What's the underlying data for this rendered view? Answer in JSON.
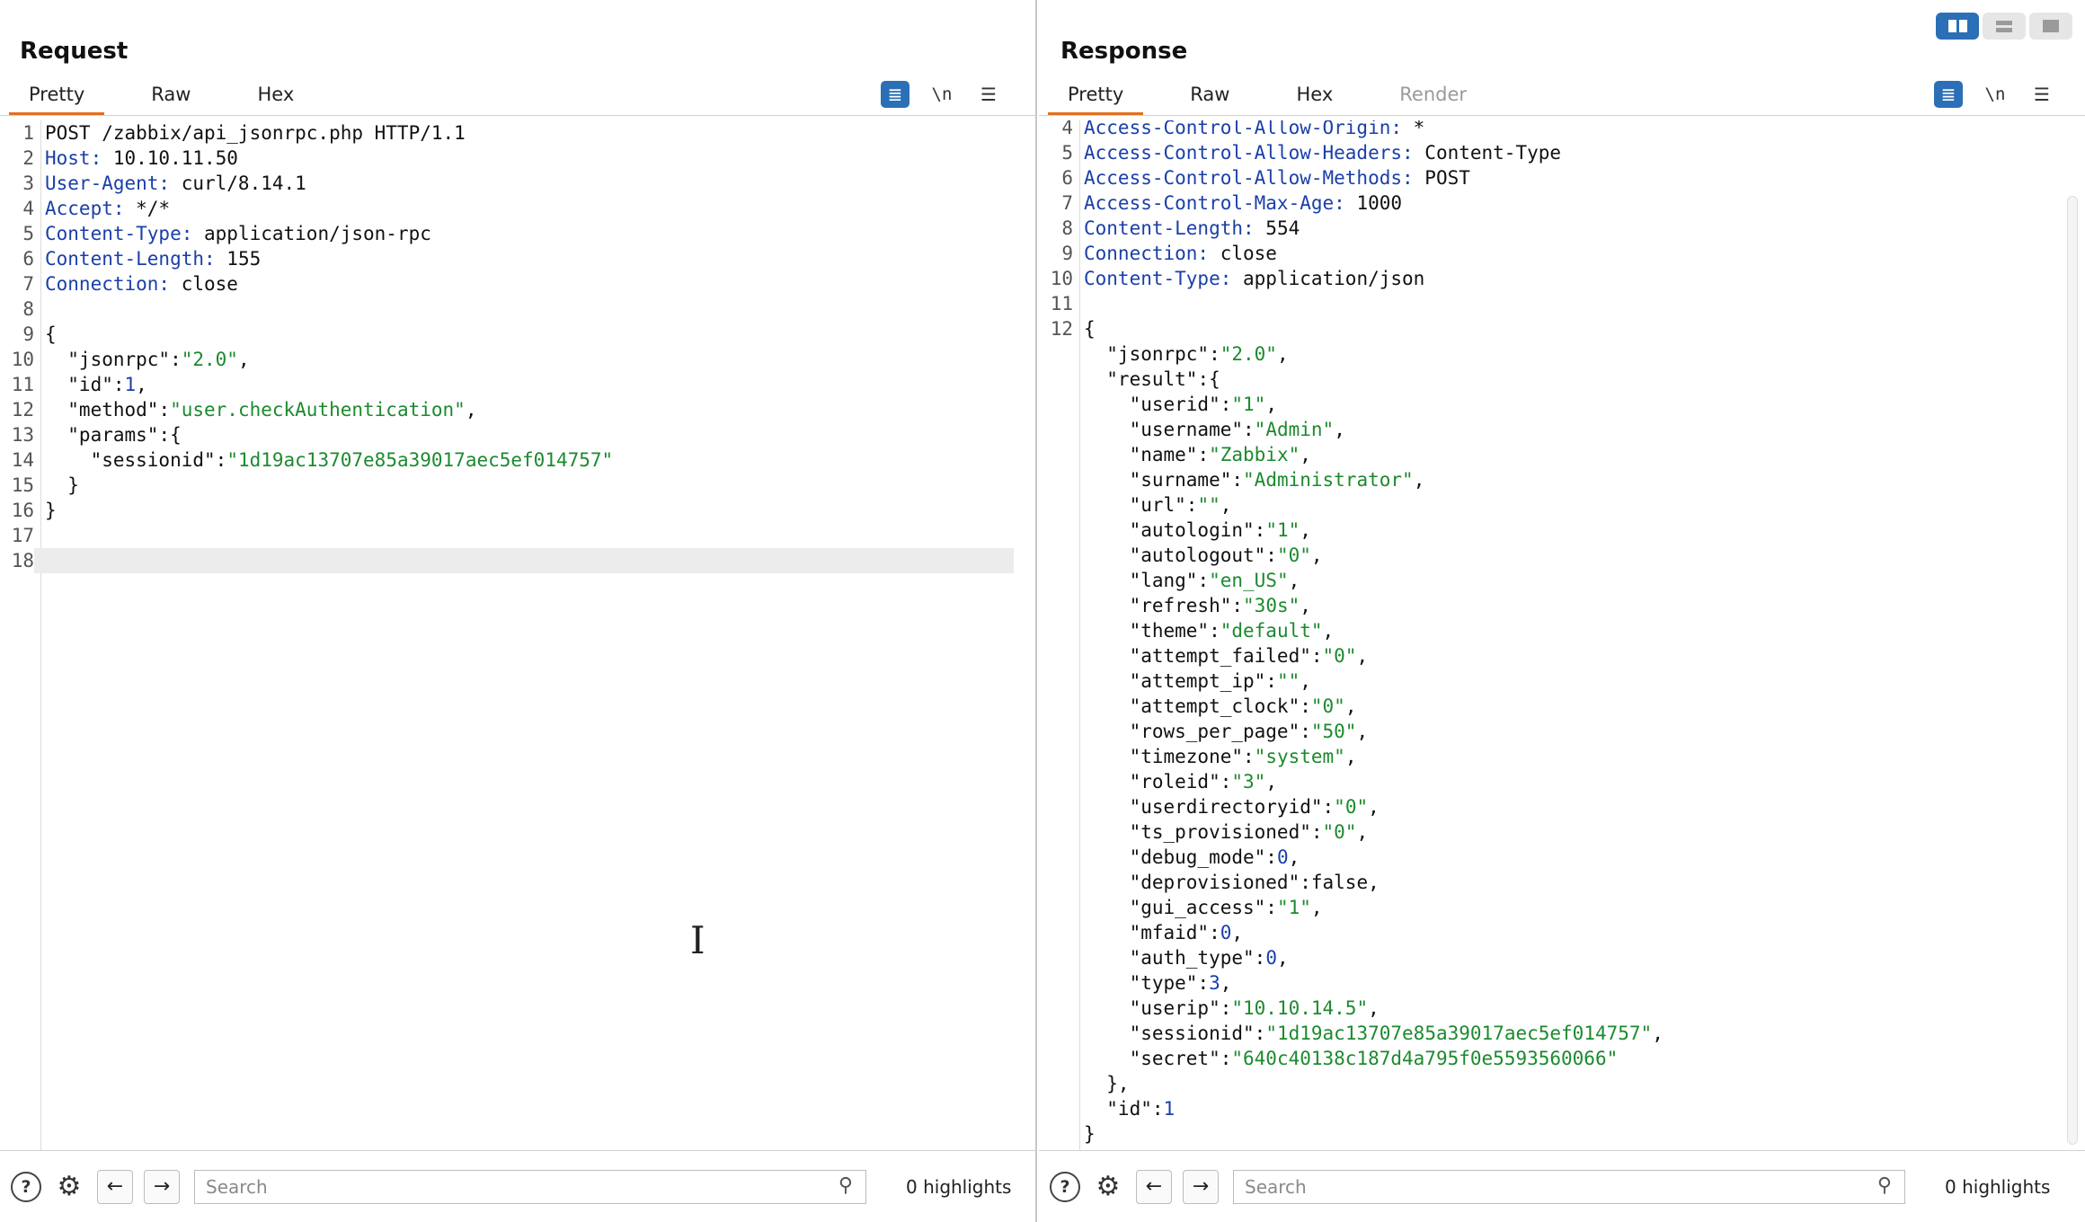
{
  "request": {
    "title": "Request",
    "tabs": [
      {
        "label": "Pretty",
        "active": true
      },
      {
        "label": "Raw",
        "active": false
      },
      {
        "label": "Hex",
        "active": false
      }
    ],
    "toolbar": {
      "wrap_icon": "wrap-lines-icon",
      "newline_label": "\\n",
      "menu_icon": "menu-icon"
    },
    "lines": [
      {
        "n": "1",
        "tokens": [
          {
            "t": "POST /zabbix/api_jsonrpc.php HTTP/1.1",
            "c": "hv"
          }
        ]
      },
      {
        "n": "2",
        "tokens": [
          {
            "t": "Host:",
            "c": "hk"
          },
          {
            "t": " 10.10.11.50",
            "c": "hv"
          }
        ]
      },
      {
        "n": "3",
        "tokens": [
          {
            "t": "User-Agent:",
            "c": "hk"
          },
          {
            "t": " curl/8.14.1",
            "c": "hv"
          }
        ]
      },
      {
        "n": "4",
        "tokens": [
          {
            "t": "Accept:",
            "c": "hk"
          },
          {
            "t": " */*",
            "c": "hv"
          }
        ]
      },
      {
        "n": "5",
        "tokens": [
          {
            "t": "Content-Type:",
            "c": "hk"
          },
          {
            "t": " application/json-rpc",
            "c": "hv"
          }
        ]
      },
      {
        "n": "6",
        "tokens": [
          {
            "t": "Content-Length:",
            "c": "hk"
          },
          {
            "t": " 155",
            "c": "hv"
          }
        ]
      },
      {
        "n": "7",
        "tokens": [
          {
            "t": "Connection:",
            "c": "hk"
          },
          {
            "t": " close",
            "c": "hv"
          }
        ]
      },
      {
        "n": "8",
        "tokens": []
      },
      {
        "n": "9",
        "tokens": [
          {
            "t": "{",
            "c": "p"
          }
        ]
      },
      {
        "n": "10",
        "tokens": [
          {
            "t": "  \"jsonrpc\"",
            "c": "jk"
          },
          {
            "t": ":",
            "c": "p"
          },
          {
            "t": "\"2.0\"",
            "c": "js"
          },
          {
            "t": ",",
            "c": "p"
          }
        ]
      },
      {
        "n": "11",
        "tokens": [
          {
            "t": "  \"id\"",
            "c": "jk"
          },
          {
            "t": ":",
            "c": "p"
          },
          {
            "t": "1",
            "c": "jn"
          },
          {
            "t": ",",
            "c": "p"
          }
        ]
      },
      {
        "n": "12",
        "tokens": [
          {
            "t": "  \"method\"",
            "c": "jk"
          },
          {
            "t": ":",
            "c": "p"
          },
          {
            "t": "\"user.checkAuthentication\"",
            "c": "js"
          },
          {
            "t": ",",
            "c": "p"
          }
        ]
      },
      {
        "n": "13",
        "tokens": [
          {
            "t": "  \"params\"",
            "c": "jk"
          },
          {
            "t": ":{",
            "c": "p"
          }
        ]
      },
      {
        "n": "14",
        "tokens": [
          {
            "t": "    \"sessionid\"",
            "c": "jk"
          },
          {
            "t": ":",
            "c": "p"
          },
          {
            "t": "\"1d19ac13707e85a39017aec5ef014757\"",
            "c": "js"
          }
        ]
      },
      {
        "n": "15",
        "tokens": [
          {
            "t": "  }",
            "c": "p"
          }
        ]
      },
      {
        "n": "16",
        "tokens": [
          {
            "t": "}",
            "c": "p"
          }
        ]
      },
      {
        "n": "17",
        "tokens": []
      },
      {
        "n": "18",
        "tokens": [],
        "current": true
      }
    ],
    "search_placeholder": "Search",
    "highlights": "0 highlights"
  },
  "response": {
    "title": "Response",
    "tabs": [
      {
        "label": "Pretty",
        "active": true
      },
      {
        "label": "Raw",
        "active": false
      },
      {
        "label": "Hex",
        "active": false
      },
      {
        "label": "Render",
        "active": false,
        "disabled": true
      }
    ],
    "toolbar": {
      "wrap_icon": "wrap-lines-icon",
      "newline_label": "\\n",
      "menu_icon": "menu-icon"
    },
    "lines": [
      {
        "n": "4",
        "tokens": [
          {
            "t": "Access-Control-Allow-Origin:",
            "c": "hk"
          },
          {
            "t": " *",
            "c": "hv"
          }
        ]
      },
      {
        "n": "5",
        "tokens": [
          {
            "t": "Access-Control-Allow-Headers:",
            "c": "hk"
          },
          {
            "t": " Content-Type",
            "c": "hv"
          }
        ]
      },
      {
        "n": "6",
        "tokens": [
          {
            "t": "Access-Control-Allow-Methods:",
            "c": "hk"
          },
          {
            "t": " POST",
            "c": "hv"
          }
        ]
      },
      {
        "n": "7",
        "tokens": [
          {
            "t": "Access-Control-Max-Age:",
            "c": "hk"
          },
          {
            "t": " 1000",
            "c": "hv"
          }
        ]
      },
      {
        "n": "8",
        "tokens": [
          {
            "t": "Content-Length:",
            "c": "hk"
          },
          {
            "t": " 554",
            "c": "hv"
          }
        ]
      },
      {
        "n": "9",
        "tokens": [
          {
            "t": "Connection:",
            "c": "hk"
          },
          {
            "t": " close",
            "c": "hv"
          }
        ]
      },
      {
        "n": "10",
        "tokens": [
          {
            "t": "Content-Type:",
            "c": "hk"
          },
          {
            "t": " application/json",
            "c": "hv"
          }
        ]
      },
      {
        "n": "11",
        "tokens": []
      },
      {
        "n": "12",
        "tokens": [
          {
            "t": "{",
            "c": "p"
          }
        ]
      },
      {
        "n": "",
        "tokens": [
          {
            "t": "  \"jsonrpc\"",
            "c": "jk"
          },
          {
            "t": ":",
            "c": "p"
          },
          {
            "t": "\"2.0\"",
            "c": "js"
          },
          {
            "t": ",",
            "c": "p"
          }
        ]
      },
      {
        "n": "",
        "tokens": [
          {
            "t": "  \"result\"",
            "c": "jk"
          },
          {
            "t": ":{",
            "c": "p"
          }
        ]
      },
      {
        "n": "",
        "tokens": [
          {
            "t": "    \"userid\"",
            "c": "jk"
          },
          {
            "t": ":",
            "c": "p"
          },
          {
            "t": "\"1\"",
            "c": "js"
          },
          {
            "t": ",",
            "c": "p"
          }
        ]
      },
      {
        "n": "",
        "tokens": [
          {
            "t": "    \"username\"",
            "c": "jk"
          },
          {
            "t": ":",
            "c": "p"
          },
          {
            "t": "\"Admin\"",
            "c": "js"
          },
          {
            "t": ",",
            "c": "p"
          }
        ]
      },
      {
        "n": "",
        "tokens": [
          {
            "t": "    \"name\"",
            "c": "jk"
          },
          {
            "t": ":",
            "c": "p"
          },
          {
            "t": "\"Zabbix\"",
            "c": "js"
          },
          {
            "t": ",",
            "c": "p"
          }
        ]
      },
      {
        "n": "",
        "tokens": [
          {
            "t": "    \"surname\"",
            "c": "jk"
          },
          {
            "t": ":",
            "c": "p"
          },
          {
            "t": "\"Administrator\"",
            "c": "js"
          },
          {
            "t": ",",
            "c": "p"
          }
        ]
      },
      {
        "n": "",
        "tokens": [
          {
            "t": "    \"url\"",
            "c": "jk"
          },
          {
            "t": ":",
            "c": "p"
          },
          {
            "t": "\"\"",
            "c": "js"
          },
          {
            "t": ",",
            "c": "p"
          }
        ]
      },
      {
        "n": "",
        "tokens": [
          {
            "t": "    \"autologin\"",
            "c": "jk"
          },
          {
            "t": ":",
            "c": "p"
          },
          {
            "t": "\"1\"",
            "c": "js"
          },
          {
            "t": ",",
            "c": "p"
          }
        ]
      },
      {
        "n": "",
        "tokens": [
          {
            "t": "    \"autologout\"",
            "c": "jk"
          },
          {
            "t": ":",
            "c": "p"
          },
          {
            "t": "\"0\"",
            "c": "js"
          },
          {
            "t": ",",
            "c": "p"
          }
        ]
      },
      {
        "n": "",
        "tokens": [
          {
            "t": "    \"lang\"",
            "c": "jk"
          },
          {
            "t": ":",
            "c": "p"
          },
          {
            "t": "\"en_US\"",
            "c": "js"
          },
          {
            "t": ",",
            "c": "p"
          }
        ]
      },
      {
        "n": "",
        "tokens": [
          {
            "t": "    \"refresh\"",
            "c": "jk"
          },
          {
            "t": ":",
            "c": "p"
          },
          {
            "t": "\"30s\"",
            "c": "js"
          },
          {
            "t": ",",
            "c": "p"
          }
        ]
      },
      {
        "n": "",
        "tokens": [
          {
            "t": "    \"theme\"",
            "c": "jk"
          },
          {
            "t": ":",
            "c": "p"
          },
          {
            "t": "\"default\"",
            "c": "js"
          },
          {
            "t": ",",
            "c": "p"
          }
        ]
      },
      {
        "n": "",
        "tokens": [
          {
            "t": "    \"attempt_failed\"",
            "c": "jk"
          },
          {
            "t": ":",
            "c": "p"
          },
          {
            "t": "\"0\"",
            "c": "js"
          },
          {
            "t": ",",
            "c": "p"
          }
        ]
      },
      {
        "n": "",
        "tokens": [
          {
            "t": "    \"attempt_ip\"",
            "c": "jk"
          },
          {
            "t": ":",
            "c": "p"
          },
          {
            "t": "\"\"",
            "c": "js"
          },
          {
            "t": ",",
            "c": "p"
          }
        ]
      },
      {
        "n": "",
        "tokens": [
          {
            "t": "    \"attempt_clock\"",
            "c": "jk"
          },
          {
            "t": ":",
            "c": "p"
          },
          {
            "t": "\"0\"",
            "c": "js"
          },
          {
            "t": ",",
            "c": "p"
          }
        ]
      },
      {
        "n": "",
        "tokens": [
          {
            "t": "    \"rows_per_page\"",
            "c": "jk"
          },
          {
            "t": ":",
            "c": "p"
          },
          {
            "t": "\"50\"",
            "c": "js"
          },
          {
            "t": ",",
            "c": "p"
          }
        ]
      },
      {
        "n": "",
        "tokens": [
          {
            "t": "    \"timezone\"",
            "c": "jk"
          },
          {
            "t": ":",
            "c": "p"
          },
          {
            "t": "\"system\"",
            "c": "js"
          },
          {
            "t": ",",
            "c": "p"
          }
        ]
      },
      {
        "n": "",
        "tokens": [
          {
            "t": "    \"roleid\"",
            "c": "jk"
          },
          {
            "t": ":",
            "c": "p"
          },
          {
            "t": "\"3\"",
            "c": "js"
          },
          {
            "t": ",",
            "c": "p"
          }
        ]
      },
      {
        "n": "",
        "tokens": [
          {
            "t": "    \"userdirectoryid\"",
            "c": "jk"
          },
          {
            "t": ":",
            "c": "p"
          },
          {
            "t": "\"0\"",
            "c": "js"
          },
          {
            "t": ",",
            "c": "p"
          }
        ]
      },
      {
        "n": "",
        "tokens": [
          {
            "t": "    \"ts_provisioned\"",
            "c": "jk"
          },
          {
            "t": ":",
            "c": "p"
          },
          {
            "t": "\"0\"",
            "c": "js"
          },
          {
            "t": ",",
            "c": "p"
          }
        ]
      },
      {
        "n": "",
        "tokens": [
          {
            "t": "    \"debug_mode\"",
            "c": "jk"
          },
          {
            "t": ":",
            "c": "p"
          },
          {
            "t": "0",
            "c": "jn"
          },
          {
            "t": ",",
            "c": "p"
          }
        ]
      },
      {
        "n": "",
        "tokens": [
          {
            "t": "    \"deprovisioned\"",
            "c": "jk"
          },
          {
            "t": ":",
            "c": "p"
          },
          {
            "t": "false",
            "c": "jb"
          },
          {
            "t": ",",
            "c": "p"
          }
        ]
      },
      {
        "n": "",
        "tokens": [
          {
            "t": "    \"gui_access\"",
            "c": "jk"
          },
          {
            "t": ":",
            "c": "p"
          },
          {
            "t": "\"1\"",
            "c": "js"
          },
          {
            "t": ",",
            "c": "p"
          }
        ]
      },
      {
        "n": "",
        "tokens": [
          {
            "t": "    \"mfaid\"",
            "c": "jk"
          },
          {
            "t": ":",
            "c": "p"
          },
          {
            "t": "0",
            "c": "jn"
          },
          {
            "t": ",",
            "c": "p"
          }
        ]
      },
      {
        "n": "",
        "tokens": [
          {
            "t": "    \"auth_type\"",
            "c": "jk"
          },
          {
            "t": ":",
            "c": "p"
          },
          {
            "t": "0",
            "c": "jn"
          },
          {
            "t": ",",
            "c": "p"
          }
        ]
      },
      {
        "n": "",
        "tokens": [
          {
            "t": "    \"type\"",
            "c": "jk"
          },
          {
            "t": ":",
            "c": "p"
          },
          {
            "t": "3",
            "c": "jn"
          },
          {
            "t": ",",
            "c": "p"
          }
        ]
      },
      {
        "n": "",
        "tokens": [
          {
            "t": "    \"userip\"",
            "c": "jk"
          },
          {
            "t": ":",
            "c": "p"
          },
          {
            "t": "\"10.10.14.5\"",
            "c": "js"
          },
          {
            "t": ",",
            "c": "p"
          }
        ]
      },
      {
        "n": "",
        "tokens": [
          {
            "t": "    \"sessionid\"",
            "c": "jk"
          },
          {
            "t": ":",
            "c": "p"
          },
          {
            "t": "\"1d19ac13707e85a39017aec5ef014757\"",
            "c": "js"
          },
          {
            "t": ",",
            "c": "p"
          }
        ]
      },
      {
        "n": "",
        "tokens": [
          {
            "t": "    \"secret\"",
            "c": "jk"
          },
          {
            "t": ":",
            "c": "p"
          },
          {
            "t": "\"640c40138c187d4a795f0e5593560066\"",
            "c": "js"
          }
        ]
      },
      {
        "n": "",
        "tokens": [
          {
            "t": "  },",
            "c": "p"
          }
        ]
      },
      {
        "n": "",
        "tokens": [
          {
            "t": "  \"id\"",
            "c": "jk"
          },
          {
            "t": ":",
            "c": "p"
          },
          {
            "t": "1",
            "c": "jn"
          }
        ]
      },
      {
        "n": "",
        "tokens": [
          {
            "t": "}",
            "c": "p"
          }
        ]
      }
    ],
    "search_placeholder": "Search",
    "highlights": "0 highlights"
  },
  "layout_buttons": [
    {
      "name": "layout-side-by-side-icon",
      "active": true
    },
    {
      "name": "layout-stacked-icon",
      "active": false
    },
    {
      "name": "layout-single-icon",
      "active": false
    }
  ],
  "icons": {
    "help": "help-icon",
    "settings": "gear-icon",
    "back": "arrow-left-icon",
    "forward": "arrow-right-icon",
    "search": "search-icon"
  },
  "colors": {
    "accent_tab": "#e3701d",
    "toggle_active": "#2b6fb6",
    "header_key": "#1a3fa8",
    "json_string": "#1c8a2e"
  }
}
